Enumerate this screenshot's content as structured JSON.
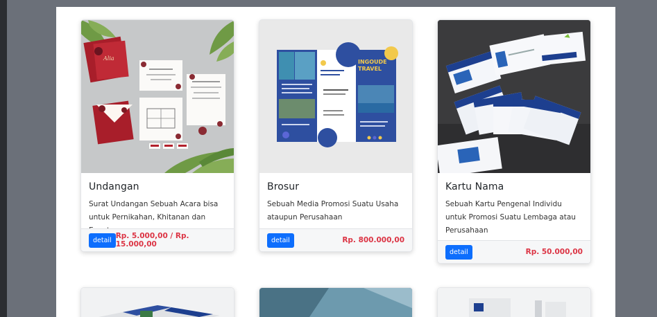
{
  "cards": [
    {
      "title": "Undangan",
      "description": "Surat Undangan Sebuah Acara bisa untuk Pernikahan, Khitanan dan Event",
      "button_label": "detail",
      "price": "Rp. 5.000,00 / Rp. 15.000,00",
      "image_icon": "invitation-image"
    },
    {
      "title": "Brosur",
      "description": "Sebuah Media Promosi Suatu Usaha ataupun Perusahaan",
      "button_label": "detail",
      "price": "Rp. 800.000,00",
      "image_icon": "brochure-image",
      "image_text": "INGOUDE TRAVEL"
    },
    {
      "title": "Kartu Nama",
      "description": "Sebuah Kartu Pengenal Individu untuk Promosi Suatu Lembaga atau Perusahaan",
      "button_label": "detail",
      "price": "Rp. 50.000,00",
      "image_icon": "business-card-image"
    }
  ],
  "colors": {
    "accent": "#0d6efd",
    "price": "#dc3545",
    "background": "#6b7079"
  }
}
